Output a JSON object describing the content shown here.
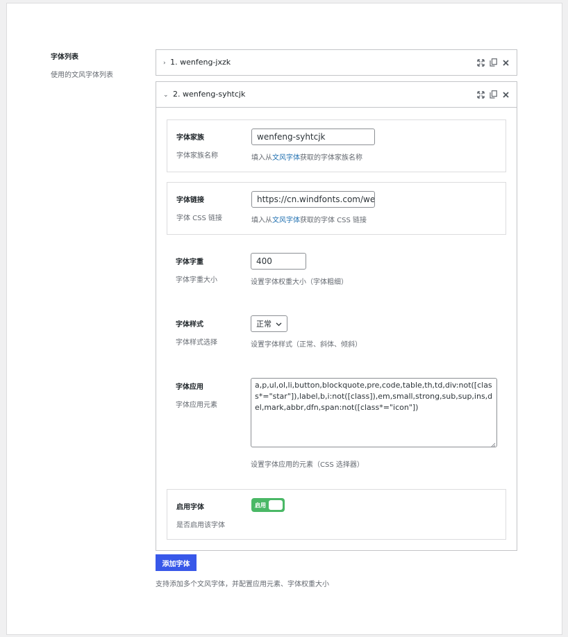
{
  "section": {
    "title": "字体列表",
    "description": "使用的文风字体列表"
  },
  "items": [
    {
      "index_label": "1. wenfeng-jxzk",
      "expanded": false
    },
    {
      "index_label": "2. wenfeng-syhtcjk",
      "expanded": true
    }
  ],
  "icons": {
    "collapsed": "chevron-right-icon",
    "expanded": "chevron-down-icon",
    "tools": [
      "expand-icon",
      "copy-icon",
      "close-icon"
    ]
  },
  "fields": {
    "family": {
      "title": "字体家族",
      "desc": "字体家族名称",
      "value": "wenfeng-syhtcjk",
      "help_prefix": "填入从",
      "help_link": "文风字体",
      "help_suffix": "获取的字体家族名称"
    },
    "link": {
      "title": "字体链接",
      "desc": "字体 CSS 链接",
      "value": "https://cn.windfonts.com/wenf",
      "help_prefix": "填入从",
      "help_link": "文风字体",
      "help_suffix": "获取的字体 CSS 链接"
    },
    "weight": {
      "title": "字体字重",
      "desc": "字体字重大小",
      "value": "400",
      "help": "设置字体权重大小（字体粗细）"
    },
    "style": {
      "title": "字体样式",
      "desc": "字体样式选择",
      "value": "正常",
      "help": "设置字体样式（正常、斜体、倾斜）"
    },
    "apply": {
      "title": "字体应用",
      "desc": "字体应用元素",
      "value": "a,p,ul,ol,li,button,blockquote,pre,code,table,th,td,div:not([class*=\"star\"]),label,b,i:not([class]),em,small,strong,sub,sup,ins,del,mark,abbr,dfn,span:not([class*=\"icon\"])",
      "help": "设置字体应用的元素（CSS 选择器）"
    },
    "enable": {
      "title": "启用字体",
      "desc": "是否启用该字体",
      "toggle_label": "启用",
      "enabled": true
    }
  },
  "add_button": "添加字体",
  "footer_help": "支持添加多个文风字体，并配置应用元素、字体权重大小",
  "colors": {
    "primary": "#3858e9",
    "toggle_on": "#4ab866",
    "link": "#2271b1"
  }
}
